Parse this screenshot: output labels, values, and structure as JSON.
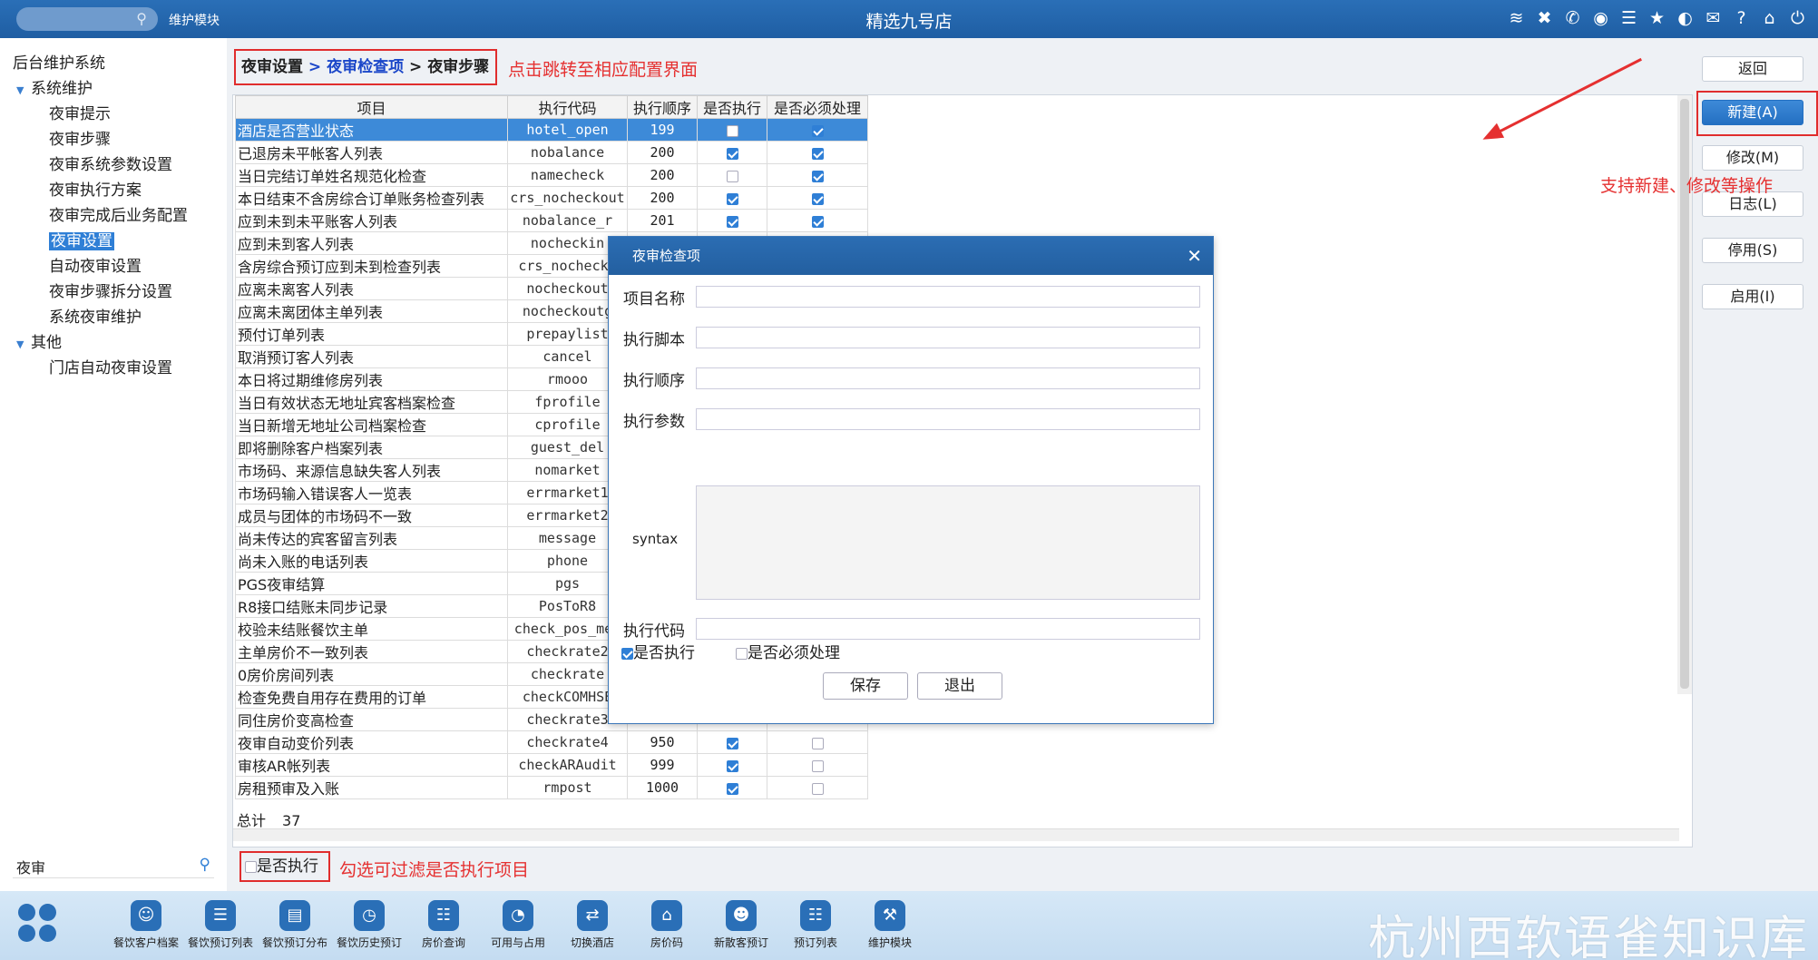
{
  "header": {
    "module": "维护模块",
    "title": "精选九号店",
    "icons": [
      "wifi-icon",
      "tools-icon",
      "phone-icon",
      "palette-icon",
      "menu-icon",
      "star-icon",
      "contrast-icon",
      "mail-icon",
      "help-icon",
      "home-icon",
      "power-icon"
    ]
  },
  "sidebar": {
    "items": [
      {
        "label": "后台维护系统",
        "level": 0
      },
      {
        "label": "系统维护",
        "level": 1,
        "expanded": true
      },
      {
        "label": "夜审提示",
        "level": 2
      },
      {
        "label": "夜审步骤",
        "level": 2
      },
      {
        "label": "夜审系统参数设置",
        "level": 2
      },
      {
        "label": "夜审执行方案",
        "level": 2
      },
      {
        "label": "夜审完成后业务配置",
        "level": 2
      },
      {
        "label": "夜审设置",
        "level": 2,
        "selected": true
      },
      {
        "label": "自动夜审设置",
        "level": 2
      },
      {
        "label": "夜审步骤拆分设置",
        "level": 2
      },
      {
        "label": "系统夜审维护",
        "level": 2
      },
      {
        "label": "其他",
        "level": 1,
        "expanded": true
      },
      {
        "label": "门店自动夜审设置",
        "level": 2
      }
    ],
    "search_value": "夜审"
  },
  "breadcrumb": {
    "part1": "夜审设置",
    "part2": "夜审检查项",
    "part3": "夜审步骤",
    "sep": ">"
  },
  "annotations": {
    "crumb_note": "点击跳转至相应配置界面",
    "btn_note": "支持新建、修改等操作",
    "filter_note": "勾选可过滤是否执行项目"
  },
  "table": {
    "headers": [
      "项目",
      "执行代码",
      "执行顺序",
      "是否执行",
      "是否必须处理"
    ],
    "rows": [
      [
        "酒店是否营业状态",
        "hotel_open",
        "199",
        false,
        true
      ],
      [
        "已退房未平帐客人列表",
        "nobalance",
        "200",
        true,
        true
      ],
      [
        "当日完结订单姓名规范化检查",
        "namecheck",
        "200",
        false,
        true
      ],
      [
        "本日结束不含房综合订单账务检查列表",
        "crs_nocheckout",
        "200",
        true,
        true
      ],
      [
        "应到未到未平账客人列表",
        "nobalance_r",
        "201",
        true,
        true
      ],
      [
        "应到未到客人列表",
        "nocheckin",
        "",
        false,
        false
      ],
      [
        "含房综合预订应到未到检查列表",
        "crs_nochecki",
        "",
        false,
        false
      ],
      [
        "应离未离客人列表",
        "nocheckout",
        "",
        false,
        false
      ],
      [
        "应离未离团体主单列表",
        "nocheckoutg",
        "",
        false,
        false
      ],
      [
        "预付订单列表",
        "prepaylist",
        "",
        false,
        false
      ],
      [
        "取消预订客人列表",
        "cancel",
        "",
        false,
        false
      ],
      [
        "本日将过期维修房列表",
        "rmooo",
        "",
        false,
        false
      ],
      [
        "当日有效状态无地址宾客档案检查",
        "fprofile",
        "",
        false,
        false
      ],
      [
        "当日新增无地址公司档案检查",
        "cprofile",
        "",
        false,
        false
      ],
      [
        "即将删除客户档案列表",
        "guest_del",
        "",
        false,
        false
      ],
      [
        "市场码、来源信息缺失客人列表",
        "nomarket",
        "",
        false,
        false
      ],
      [
        "市场码输入错误客人一览表",
        "errmarket1",
        "",
        false,
        false
      ],
      [
        "成员与团体的市场码不一致",
        "errmarket2",
        "",
        false,
        false
      ],
      [
        "尚未传达的宾客留言列表",
        "message",
        "",
        false,
        false
      ],
      [
        "尚未入账的电话列表",
        "phone",
        "",
        false,
        false
      ],
      [
        "PGS夜审结算",
        "pgs",
        "",
        false,
        false
      ],
      [
        "R8接口结账未同步记录",
        "PosToR8",
        "",
        false,
        false
      ],
      [
        "校验未结账餐饮主单",
        "check_pos_mer",
        "",
        false,
        false
      ],
      [
        "主单房价不一致列表",
        "checkrate2",
        "",
        false,
        false
      ],
      [
        "0房价房间列表",
        "checkrate",
        "",
        false,
        false
      ],
      [
        "检查免费自用存在费用的订单",
        "checkCOMHSE",
        "",
        false,
        false
      ],
      [
        "同住房价变高检查",
        "checkrate3",
        "",
        false,
        false
      ],
      [
        "夜审自动变价列表",
        "checkrate4",
        "950",
        true,
        false
      ],
      [
        "审核AR帐列表",
        "checkARAudit",
        "999",
        true,
        false
      ],
      [
        "房租预审及入账",
        "rmpost",
        "1000",
        true,
        false
      ]
    ],
    "total_label": "总计",
    "total_count": "37"
  },
  "buttons": {
    "back": "返回",
    "new": "新建(A)",
    "edit": "修改(M)",
    "log": "日志(L)",
    "disable": "停用(S)",
    "enable": "启用(I)"
  },
  "filter": {
    "label": "是否执行",
    "checked": false
  },
  "dialog": {
    "title": "夜审检查项",
    "fields": {
      "name": "项目名称",
      "script": "执行脚本",
      "order": "执行顺序",
      "params": "执行参数",
      "syntax": "syntax",
      "code": "执行代码"
    },
    "chk_execute": "是否执行",
    "chk_must": "是否必须处理",
    "save": "保存",
    "exit": "退出"
  },
  "taskbar": {
    "apps": [
      "餐饮客户档案",
      "餐饮预订列表",
      "餐饮预订分布",
      "餐饮历史预订",
      "房价查询",
      "可用与占用",
      "切换酒店",
      "房价码",
      "新散客预订",
      "预订列表",
      "维护模块"
    ],
    "watermark": "杭州西软语雀知识库"
  }
}
